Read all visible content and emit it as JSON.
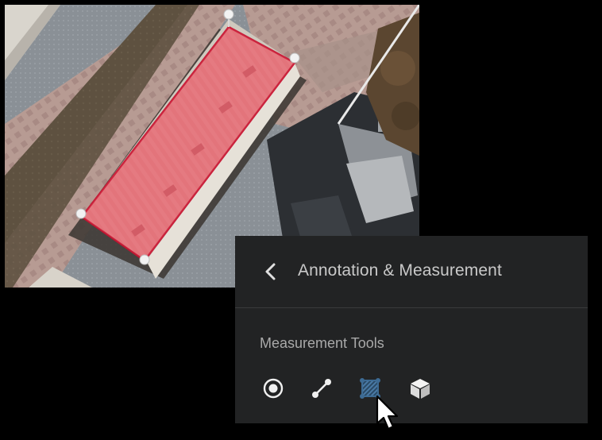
{
  "panel": {
    "title": "Annotation & Measurement",
    "section_label": "Measurement Tools",
    "back_icon": "chevron-left-icon",
    "tools": [
      {
        "name": "point-measure-tool",
        "icon": "point-icon"
      },
      {
        "name": "line-measure-tool",
        "icon": "line-icon"
      },
      {
        "name": "area-measure-tool",
        "icon": "polygon-area-icon",
        "active": true
      },
      {
        "name": "volume-measure-tool",
        "icon": "cube-icon"
      }
    ]
  },
  "colors": {
    "panel_bg": "#222324",
    "active_tool": "#3d6b94",
    "selection_fill": "#e05060",
    "selection_stroke": "#c8102e"
  }
}
